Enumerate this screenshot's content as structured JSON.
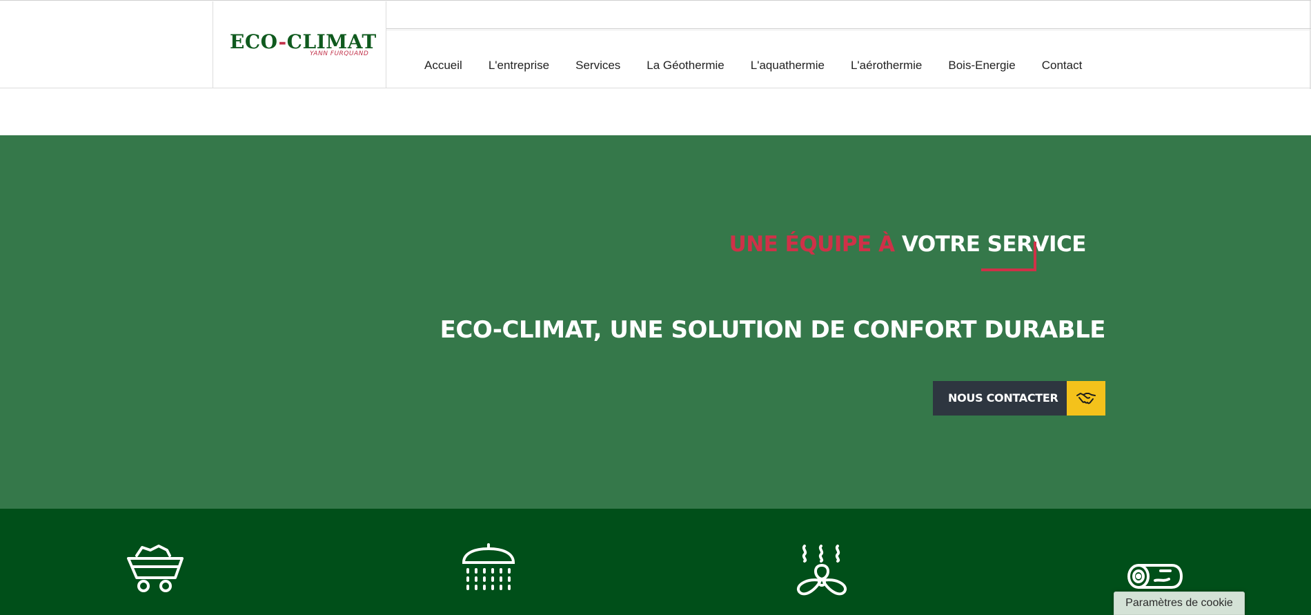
{
  "header": {
    "logo": {
      "name": "ECO-CLIMAT",
      "part1": "ECO",
      "dash": "-",
      "part2": "CLIMAT",
      "subtitle": "YANN FURQUAND"
    },
    "nav": [
      {
        "label": "Accueil"
      },
      {
        "label": "L'entreprise"
      },
      {
        "label": "Services"
      },
      {
        "label": "La Géothermie"
      },
      {
        "label": "L'aquathermie"
      },
      {
        "label": "L'aérothermie"
      },
      {
        "label": "Bois-Energie"
      },
      {
        "label": "Contact"
      }
    ]
  },
  "hero": {
    "kicker_red": "UNE ÉQUIPE À",
    "kicker_white": "VOTRE SERVICE",
    "title": "ECO-CLIMAT, UNE SOLUTION DE CONFORT DURABLE",
    "cta_label": "NOUS CONTACTER",
    "cta_icon": "handshake-icon"
  },
  "features": {
    "icons": [
      "coal-cart-icon",
      "shower-icon",
      "heat-fan-icon",
      "wood-log-icon"
    ]
  },
  "cookie": {
    "label": "Paramètres de cookie"
  },
  "colors": {
    "hero_green": "#35784a",
    "dark_green": "#004f19",
    "accent_red": "#cf3148",
    "cta_dark": "#2e3640",
    "cta_yellow": "#f4c21b",
    "logo_green": "#0f5a1e"
  }
}
